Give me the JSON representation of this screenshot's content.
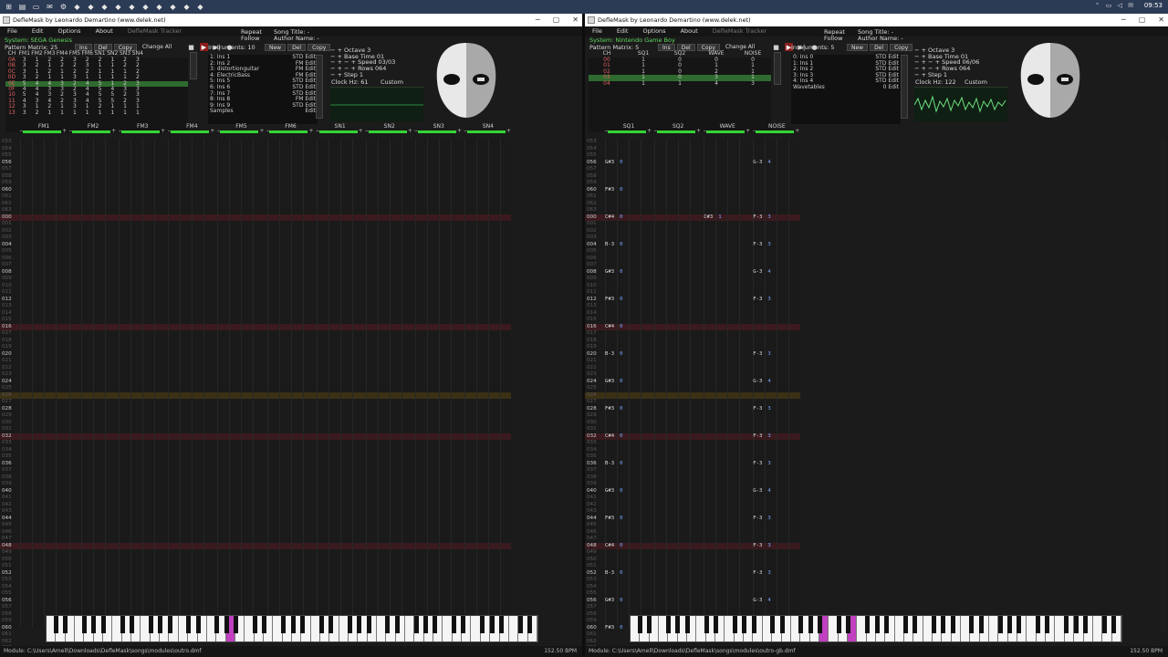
{
  "taskbar": {
    "icons": [
      "windows-icon",
      "file-icon",
      "folder-icon",
      "mail-icon",
      "settings-icon",
      "app-icon",
      "app-icon",
      "app-icon",
      "app-icon",
      "app-icon",
      "app-icon",
      "app-icon",
      "app-icon",
      "app-icon",
      "app-icon"
    ],
    "tray": "⌃ ▭ ◁ ✉",
    "time": "09:53"
  },
  "left": {
    "title": "DefleMask by Leonardo Demartino (www.delek.net)",
    "menu": [
      "File",
      "Edit",
      "Options",
      "About"
    ],
    "tracker_label": "DefleMask Tracker",
    "repeat": "Repeat",
    "follow": "Follow",
    "song_title": "Song Title: -",
    "author": "Author Name: -",
    "system": "System: SEGA Genesis",
    "pattern_matrix": "Pattern Matrix: 25",
    "btn_ins": "Ins",
    "btn_del": "Del",
    "btn_copy": "Copy",
    "change_all": "Change All",
    "channels": [
      "CH",
      "FM1",
      "FM2",
      "FM3",
      "FM4",
      "FM5",
      "FM6",
      "SN1",
      "SN2",
      "SN3",
      "SN4"
    ],
    "matrix": [
      [
        "0A",
        "3",
        "1",
        "2",
        "2",
        "3",
        "2",
        "2",
        "1",
        "2",
        "3"
      ],
      [
        "0B",
        "3",
        "2",
        "1",
        "2",
        "2",
        "3",
        "1",
        "1",
        "2",
        "2"
      ],
      [
        "0C",
        "3",
        "1",
        "2",
        "1",
        "2",
        "2",
        "1",
        "1",
        "1",
        "2"
      ],
      [
        "0D",
        "3",
        "2",
        "1",
        "1",
        "3",
        "1",
        "1",
        "1",
        "1",
        "2"
      ],
      [
        "0E",
        "5",
        "4",
        "4",
        "3",
        "2",
        "4",
        "5",
        "1",
        "2",
        "3"
      ],
      [
        "0F",
        "4",
        "4",
        "3",
        "3",
        "2",
        "4",
        "5",
        "4",
        "3",
        "3"
      ],
      [
        "10",
        "5",
        "4",
        "3",
        "2",
        "3",
        "4",
        "5",
        "5",
        "2",
        "3"
      ],
      [
        "11",
        "4",
        "3",
        "4",
        "2",
        "3",
        "4",
        "5",
        "5",
        "2",
        "3"
      ],
      [
        "12",
        "3",
        "1",
        "2",
        "1",
        "3",
        "1",
        "2",
        "1",
        "1",
        "1"
      ],
      [
        "13",
        "3",
        "2",
        "1",
        "1",
        "1",
        "1",
        "1",
        "1",
        "1",
        "1"
      ]
    ],
    "instruments_head": "Instruments: 10",
    "ins_new": "New",
    "ins_del": "Del",
    "ins_copy": "Copy",
    "instruments": [
      {
        "name": "1: Ins 1",
        "type": "STD",
        "act": "Edit"
      },
      {
        "name": "2: Ins 2",
        "type": "FM",
        "act": "Edit"
      },
      {
        "name": "3: distortionguitar",
        "type": "FM",
        "act": "Edit"
      },
      {
        "name": "4: ElectricBass",
        "type": "FM",
        "act": "Edit"
      },
      {
        "name": "5: Ins 5",
        "type": "STD",
        "act": "Edit"
      },
      {
        "name": "6: Ins 6",
        "type": "STD",
        "act": "Edit"
      },
      {
        "name": "7: Ins 7",
        "type": "STD",
        "act": "Edit"
      },
      {
        "name": "8: Ins 8",
        "type": "FM",
        "act": "Edit"
      },
      {
        "name": "9: Ins 9",
        "type": "STD",
        "act": "Edit"
      },
      {
        "name": "Samples",
        "type": "",
        "act": "Edit"
      }
    ],
    "octave": "Octave 3",
    "base_time": "Base Time 01",
    "speed": "Speed 03/03",
    "rows": "Rows 064",
    "step": "Step 1",
    "clock": "Clock Hz: 61",
    "custom": "Custom",
    "chan_names": [
      "FM1",
      "FM2",
      "FM3",
      "FM4",
      "FM5",
      "FM6",
      "SN1",
      "SN2",
      "SN3",
      "SN4"
    ],
    "status": "Module: C:\\Users\\Amell\\Downloads\\DefleMask\\songs\\modules\\outro.dmf",
    "bpm": "152.50 BPM"
  },
  "right": {
    "title": "DefleMask by Leonardo Demartino (www.delek.net)",
    "menu": [
      "File",
      "Edit",
      "Options",
      "About"
    ],
    "tracker_label": "DefleMask Tracker",
    "repeat": "Repeat",
    "follow": "Follow",
    "song_title": "Song Title: -",
    "author": "Author Name: -",
    "system": "System: Nintendo Game Boy",
    "pattern_matrix": "Pattern Matrix: 5",
    "btn_ins": "Ins",
    "btn_del": "Del",
    "btn_copy": "Copy",
    "change_all": "Change All",
    "channels": [
      "CH",
      "SQ1",
      "SQ2",
      "WAVE",
      "NOISE"
    ],
    "matrix": [
      [
        "00",
        "1",
        "0",
        "0",
        "0"
      ],
      [
        "01",
        "1",
        "0",
        "1",
        "1"
      ],
      [
        "02",
        "1",
        "0",
        "2",
        "1"
      ],
      [
        "03",
        "1",
        "0",
        "3",
        "1"
      ],
      [
        "04",
        "1",
        "1",
        "4",
        "3"
      ]
    ],
    "instruments_head": "Instruments: 5",
    "ins_new": "New",
    "ins_del": "Del",
    "ins_copy": "Copy",
    "instruments": [
      {
        "name": "0: Ins 0",
        "type": "STD",
        "act": "Edit"
      },
      {
        "name": "1: Ins 1",
        "type": "STD",
        "act": "Edit"
      },
      {
        "name": "2: Ins 2",
        "type": "STD",
        "act": "Edit"
      },
      {
        "name": "3: Ins 3",
        "type": "STD",
        "act": "Edit"
      },
      {
        "name": "4: Ins 4",
        "type": "STD",
        "act": "Edit"
      },
      {
        "name": "Wavetables",
        "type": "0",
        "act": "Edit"
      }
    ],
    "octave": "Octave 3",
    "base_time": "Base Time 01",
    "speed": "Speed 06/06",
    "rows": "Rows 064",
    "step": "Step 1",
    "clock": "Clock Hz: 122",
    "custom": "Custom",
    "chan_names": [
      "SQ1",
      "SQ2",
      "WAVE",
      "NOISE"
    ],
    "notes": [
      {
        "row": "056",
        "col": 0,
        "n": "G#3",
        "i": "0"
      },
      {
        "row": "056",
        "col": 3,
        "n": "G-3",
        "i": "4"
      },
      {
        "row": "060",
        "col": 0,
        "n": "F#3",
        "i": "0"
      },
      {
        "row": "000",
        "col": 0,
        "n": "C#4",
        "i": "0"
      },
      {
        "row": "000",
        "col": 2,
        "n": "C#3",
        "i": "1"
      },
      {
        "row": "000",
        "col": 3,
        "n": "F-3",
        "i": "3"
      },
      {
        "row": "004",
        "col": 0,
        "n": "B-3",
        "i": "0"
      },
      {
        "row": "004",
        "col": 3,
        "n": "F-3",
        "i": "3"
      },
      {
        "row": "008",
        "col": 0,
        "n": "G#3",
        "i": "0"
      },
      {
        "row": "008",
        "col": 3,
        "n": "G-3",
        "i": "4"
      },
      {
        "row": "012",
        "col": 0,
        "n": "F#3",
        "i": "0"
      },
      {
        "row": "012",
        "col": 3,
        "n": "F-3",
        "i": "3"
      },
      {
        "row": "016",
        "col": 0,
        "n": "C#4",
        "i": "0"
      },
      {
        "row": "020",
        "col": 0,
        "n": "B-3",
        "i": "0"
      },
      {
        "row": "020",
        "col": 3,
        "n": "F-3",
        "i": "3"
      },
      {
        "row": "024",
        "col": 0,
        "n": "G#3",
        "i": "0"
      },
      {
        "row": "024",
        "col": 3,
        "n": "G-3",
        "i": "4"
      },
      {
        "row": "028",
        "col": 0,
        "n": "F#3",
        "i": "0"
      },
      {
        "row": "028",
        "col": 3,
        "n": "F-3",
        "i": "3"
      },
      {
        "row": "032",
        "col": 0,
        "n": "C#4",
        "i": "0"
      },
      {
        "row": "032",
        "col": 3,
        "n": "F-3",
        "i": "3"
      },
      {
        "row": "036",
        "col": 0,
        "n": "B-3",
        "i": "0"
      },
      {
        "row": "036",
        "col": 3,
        "n": "F-3",
        "i": "3"
      },
      {
        "row": "040",
        "col": 0,
        "n": "G#3",
        "i": "0"
      },
      {
        "row": "040",
        "col": 3,
        "n": "G-3",
        "i": "4"
      },
      {
        "row": "044",
        "col": 0,
        "n": "F#3",
        "i": "0"
      },
      {
        "row": "044",
        "col": 3,
        "n": "F-3",
        "i": "3"
      },
      {
        "row": "048",
        "col": 0,
        "n": "C#4",
        "i": "0"
      },
      {
        "row": "048",
        "col": 3,
        "n": "F-3",
        "i": "3"
      },
      {
        "row": "052",
        "col": 0,
        "n": "B-3",
        "i": "0"
      },
      {
        "row": "052",
        "col": 3,
        "n": "F-3",
        "i": "3"
      },
      {
        "row": "056",
        "col": 0,
        "n": "G#3",
        "i": "0"
      },
      {
        "row": "056",
        "col": 3,
        "n": "G-3",
        "i": "4"
      },
      {
        "row": "060",
        "col": 0,
        "n": "F#3",
        "i": "0"
      }
    ],
    "status": "Module: C:\\Users\\Amell\\Downloads\\DefleMask\\songs\\modules\\outro-gb.dmf",
    "bpm": "152.50 BPM"
  },
  "left_rows": [
    "053",
    "054",
    "055",
    "056",
    "057",
    "058",
    "059",
    "060",
    "061",
    "062",
    "063",
    "000",
    "001",
    "002",
    "003",
    "004",
    "005",
    "006",
    "007",
    "008",
    "009",
    "010",
    "011",
    "012",
    "013",
    "014",
    "015",
    "016",
    "017",
    "018",
    "019",
    "020",
    "021",
    "022",
    "023",
    "024",
    "025",
    "026",
    "027",
    "028",
    "029",
    "030",
    "031",
    "032",
    "033",
    "034",
    "035",
    "036",
    "037",
    "038",
    "039",
    "040",
    "041",
    "042",
    "043",
    "044",
    "045",
    "046",
    "047",
    "048",
    "049",
    "050",
    "051",
    "052",
    "053",
    "054",
    "055",
    "056",
    "057",
    "058",
    "059",
    "060",
    "061",
    "062",
    "063"
  ],
  "right_rows": [
    "053",
    "054",
    "055",
    "056",
    "057",
    "058",
    "059",
    "060",
    "061",
    "062",
    "063",
    "000",
    "001",
    "002",
    "003",
    "004",
    "005",
    "006",
    "007",
    "008",
    "009",
    "010",
    "011",
    "012",
    "013",
    "014",
    "015",
    "016",
    "017",
    "018",
    "019",
    "020",
    "021",
    "022",
    "023",
    "024",
    "025",
    "026",
    "027",
    "028",
    "029",
    "030",
    "031",
    "032",
    "033",
    "034",
    "035",
    "036",
    "037",
    "038",
    "039",
    "040",
    "041",
    "042",
    "043",
    "044",
    "045",
    "046",
    "047",
    "048",
    "049",
    "050",
    "051",
    "052",
    "053",
    "054",
    "055",
    "056",
    "057",
    "058",
    "059",
    "060",
    "061",
    "062",
    "063"
  ],
  "colors": {
    "accent_green": "#35d535",
    "highlight_red": "#3a1a1e",
    "cursor_row": "#3b3014",
    "piano_pressed": "#c040c0",
    "system_text": "#5fd65f"
  }
}
